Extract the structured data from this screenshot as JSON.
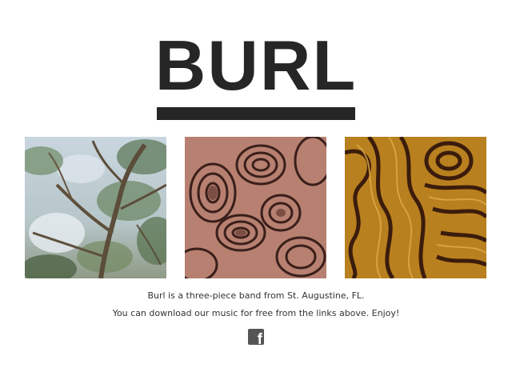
{
  "header": {
    "logo_text": "BURL"
  },
  "albums": [
    {
      "name": "album-tree-photo",
      "description_icon": "tree-canopy-image"
    },
    {
      "name": "album-burl-wood-red",
      "description_icon": "wood-grain-image"
    },
    {
      "name": "album-burl-wood-gold",
      "description_icon": "wood-grain-image"
    }
  ],
  "content": {
    "line_1": "Burl is a three-piece band from St. Augustine, FL.",
    "line_2": "You can download our music for free from the links above. Enjoy!"
  },
  "social": {
    "facebook_icon": "facebook-icon",
    "facebook_glyph": "f"
  },
  "colors": {
    "text": "#262626",
    "icon": "#555555",
    "background": "#ffffff"
  }
}
